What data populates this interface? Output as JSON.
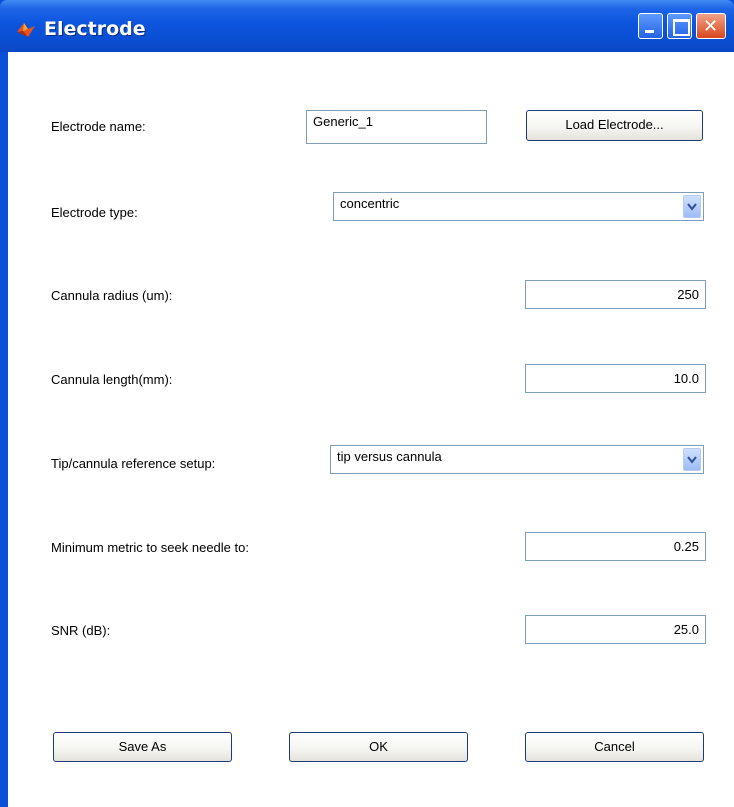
{
  "window": {
    "title": "Electrode"
  },
  "form": {
    "electrode_name": {
      "label": "Electrode name:",
      "value": "Generic_1"
    },
    "load_button": "Load Electrode...",
    "electrode_type": {
      "label": "Electrode type:",
      "value": "concentric"
    },
    "cannula_radius": {
      "label": "Cannula radius (um):",
      "value": "250"
    },
    "cannula_length": {
      "label": "Cannula length(mm):",
      "value": "10.0"
    },
    "reference_setup": {
      "label": "Tip/cannula reference setup:",
      "value": "tip versus cannula"
    },
    "min_metric": {
      "label": "Minimum metric to seek needle to:",
      "value": "0.25"
    },
    "snr": {
      "label": "SNR (dB):",
      "value": "25.0"
    }
  },
  "buttons": {
    "save_as": "Save As",
    "ok": "OK",
    "cancel": "Cancel"
  },
  "icons": {
    "app": "matlab-icon",
    "dropdown": "chevron-down-icon"
  }
}
